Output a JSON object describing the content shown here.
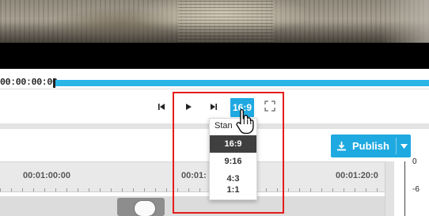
{
  "player": {
    "current_time": "00:00:00:00",
    "progress_fraction": 0.0,
    "controls": {
      "prev_icon": "skip-previous-icon",
      "play_icon": "play-icon",
      "next_icon": "skip-next-icon",
      "aspect_label": "16:9",
      "fullscreen_icon": "fullscreen-icon"
    }
  },
  "aspect_menu": {
    "header": "Stan",
    "options": [
      "16:9",
      "9:16",
      "4:3",
      "1:1"
    ],
    "selected": "16:9"
  },
  "publish": {
    "label": "Publish",
    "icon": "download-icon",
    "caret_icon": "caret-down-icon"
  },
  "timeline": {
    "tick_labels": [
      "00:01:00:00",
      "00:01:",
      "00:01:20:0"
    ]
  },
  "meter": {
    "labels": [
      "0",
      "-6"
    ]
  },
  "colors": {
    "accent": "#1fa9e1",
    "progress": "#29b5e6",
    "highlight": "#e41c1c",
    "menu_selected_bg": "#3f3f3f"
  }
}
